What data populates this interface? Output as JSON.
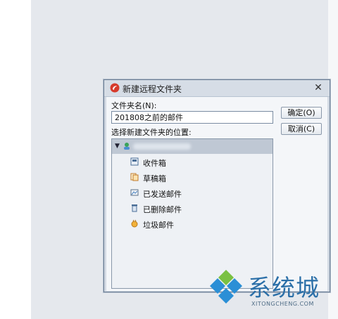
{
  "dialog": {
    "title": "新建远程文件夹",
    "close_glyph": "✕",
    "folder_name_label": "文件夹名(N):",
    "folder_name_value": "201808之前的邮件",
    "location_label": "选择新建文件夹的位置:",
    "ok_label": "确定(O)",
    "cancel_label": "取消(C)"
  },
  "tree": {
    "expand_glyph": "▼",
    "items": [
      {
        "label": "收件箱",
        "icon": "inbox-icon"
      },
      {
        "label": "草稿箱",
        "icon": "drafts-icon"
      },
      {
        "label": "已发送邮件",
        "icon": "sent-icon"
      },
      {
        "label": "已删除邮件",
        "icon": "trash-icon"
      },
      {
        "label": "垃圾邮件",
        "icon": "junk-icon"
      }
    ]
  },
  "watermark": {
    "text": "系统城",
    "sub": "XITONGCHENG.COM"
  },
  "colors": {
    "accent": "#2b6fa8",
    "logo_red": "#d63a2b"
  }
}
